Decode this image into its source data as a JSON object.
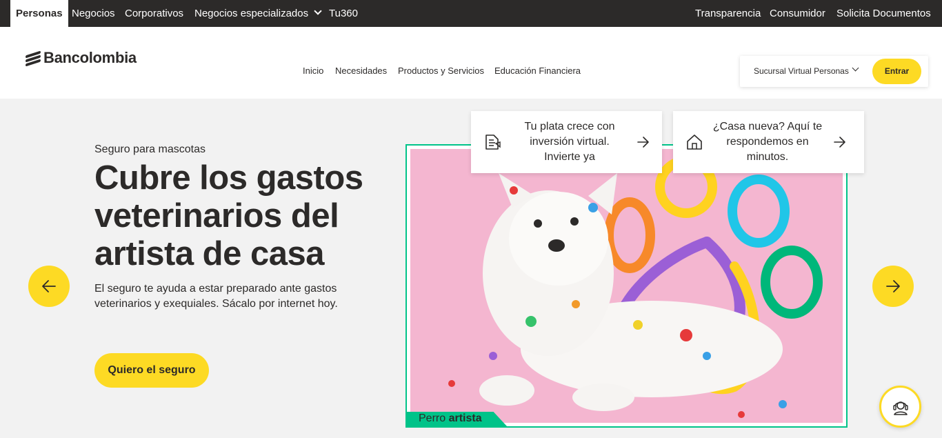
{
  "topbar": {
    "tabs": [
      "Personas",
      "Negocios",
      "Corporativos",
      "Negocios especializados",
      "Tu360"
    ],
    "right_links": [
      "Transparencia",
      "Consumidor",
      "Solicita Documentos"
    ]
  },
  "header": {
    "logo_text": "Bancolombia",
    "nav": [
      "Inicio",
      "Necesidades",
      "Productos y Servicios",
      "Educación Financiera"
    ],
    "sucursal_label": "Sucursal Virtual Personas",
    "login_label": "Entrar"
  },
  "hero": {
    "eyebrow": "Seguro para mascotas",
    "headline": "Cubre los gastos veterinarios del artista de casa",
    "description": "El seguro te ayuda a estar preparado ante gastos veterinarios y exequiales. Sácalo por internet hoy.",
    "cta_label": "Quiero el seguro",
    "image_tag_normal": "Perro ",
    "image_tag_bold": "artista"
  },
  "quick_cards": [
    {
      "text": "Tu plata crece con inversión virtual. Invierte ya",
      "icon": "document-icon"
    },
    {
      "text": "¿Casa nueva? Aquí te respondemos en minutos.",
      "icon": "house-icon"
    }
  ],
  "colors": {
    "brand_yellow": "#fdda24",
    "dark": "#2c2a29",
    "green": "#00c389",
    "pink": "#f4b6d0"
  }
}
